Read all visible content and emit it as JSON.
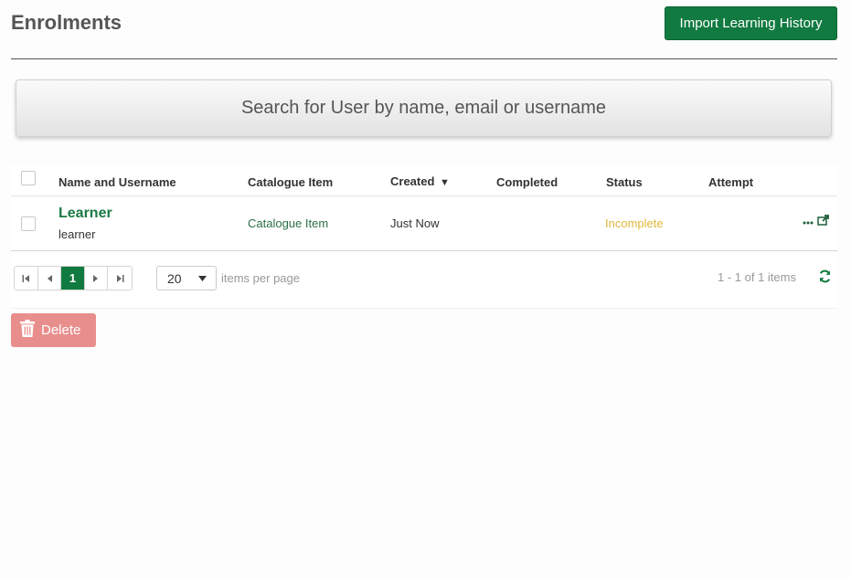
{
  "header": {
    "title": "Enrolments",
    "import_label": "Import Learning History"
  },
  "search": {
    "placeholder": "Search for User by name, email or username"
  },
  "table": {
    "columns": [
      "Name and Username",
      "Catalogue Item",
      "Created",
      "Completed",
      "Status",
      "Attempt"
    ],
    "sort_indicator": "▼",
    "rows": [
      {
        "name": "Learner",
        "username": "learner",
        "catalogue_item": "Catalogue Item",
        "created": "Just Now",
        "completed": "",
        "status": "Incomplete",
        "attempt": ""
      }
    ]
  },
  "pager": {
    "current_page": "1",
    "page_size": "20",
    "per_page_label": "items per page",
    "range_label": "1 - 1 of 1 items"
  },
  "actions": {
    "delete_label": "Delete"
  },
  "colors": {
    "primary": "#117a40",
    "link_green": "#2a6e47",
    "status_incomplete": "#e0b93a",
    "delete_disabled": "#e88f8d"
  },
  "icons": {
    "more": "more-icon",
    "open": "open-external-icon",
    "refresh": "refresh-icon",
    "trash": "trash-icon"
  }
}
